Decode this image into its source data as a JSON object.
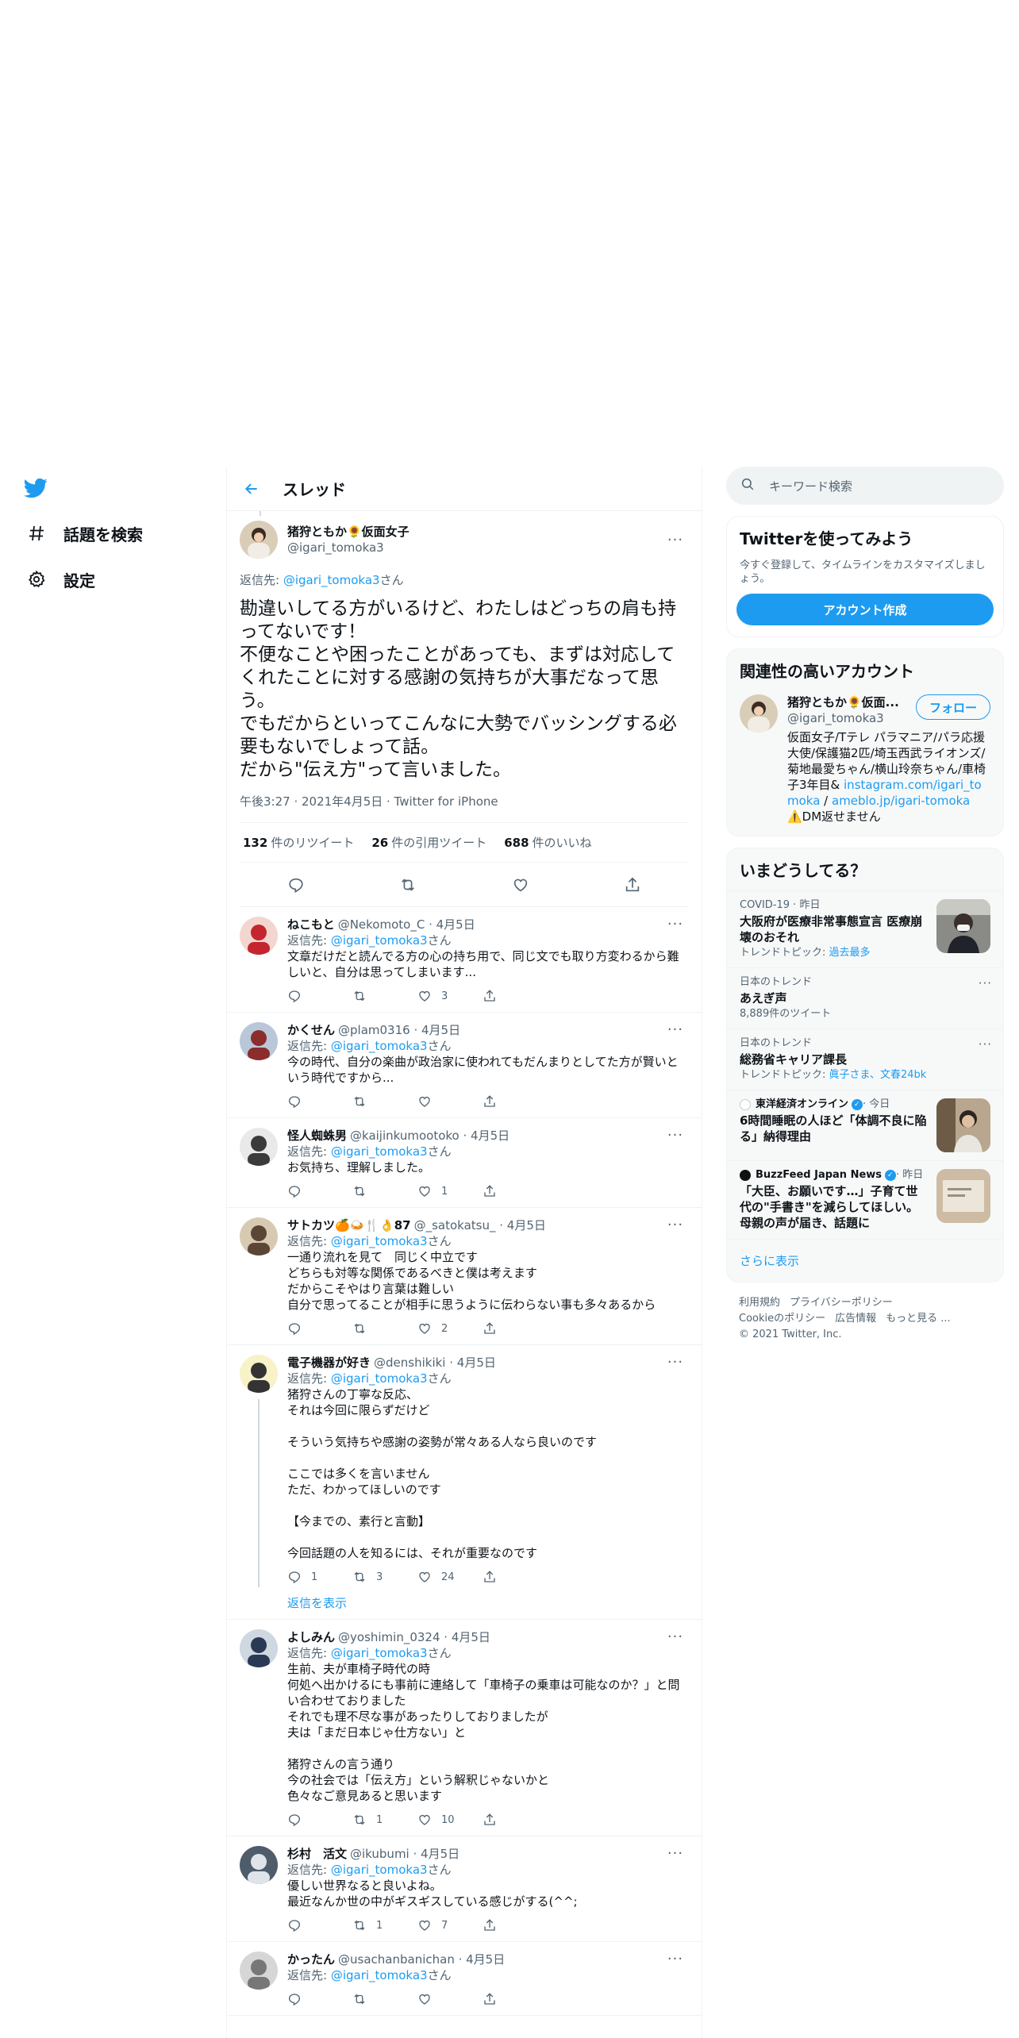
{
  "nav": {
    "logo": "twitter-logo",
    "explore_label": "話題を検索",
    "settings_label": "設定"
  },
  "header": {
    "title": "スレッド"
  },
  "main_tweet": {
    "name": "猪狩ともか🌻仮面女子",
    "handle": "@igari_tomoka3",
    "reply_prefix": "返信先: ",
    "reply_to": "@igari_tomoka3",
    "reply_suffix": "さん",
    "text": "勘違いしてる方がいるけど、わたしはどっちの肩も持ってないです！\n不便なことや困ったことがあっても、まずは対応してくれたことに対する感謝の気持ちが大事だなって思う。\nでもだからといってこんなに大勢でバッシングする必要もないでしょって話。\nだから\"伝え方\"って言いました。",
    "meta": "午後3:27 · 2021年4月5日 · Twitter for iPhone",
    "retweets": "132",
    "retweets_label": "件のリツイート",
    "quotes": "26",
    "quotes_label": "件の引用ツイート",
    "likes": "688",
    "likes_label": "件のいいね"
  },
  "replies": [
    {
      "name": "ねこもと",
      "handle": "@Nekomoto_C · 4月5日",
      "reply_to": "@igari_tomoka3",
      "text": "文章だけだと読んでる方の心の持ち用で、同じ文でも取り方変わるから難しいと、自分は思ってしまいます...",
      "replies": "",
      "retweets": "",
      "likes": "3"
    },
    {
      "name": "かくせん",
      "handle": "@plam0316 · 4月5日",
      "reply_to": "@igari_tomoka3",
      "text": "今の時代、自分の楽曲が政治家に使われてもだんまりとしてた方が賢いという時代ですから...",
      "replies": "",
      "retweets": "",
      "likes": ""
    },
    {
      "name": "怪人蜘蛛男",
      "handle": "@kaijinkumootoko · 4月5日",
      "reply_to": "@igari_tomoka3",
      "text": "お気持ち、理解しました。",
      "replies": "",
      "retweets": "",
      "likes": "1"
    },
    {
      "name": "サトカツ🍊🍛🍴👌87",
      "handle": "@_satokatsu_ · 4月5日",
      "reply_to": "@igari_tomoka3",
      "text": "一通り流れを見て　同じく中立です\nどちらも対等な関係であるべきと僕は考えます\nだからこそやはり言葉は難しい\n自分で思ってることが相手に思うように伝わらない事も多々あるから",
      "replies": "",
      "retweets": "",
      "likes": "2"
    },
    {
      "name": "電子機器が好き",
      "handle": "@denshikiki · 4月5日",
      "reply_to": "@igari_tomoka3",
      "text": "猪狩さんの丁寧な反応、\nそれは今回に限らずだけど\n\nそういう気持ちや感謝の姿勢が常々ある人なら良いのです\n\nここでは多くを言いません\nただ、わかってほしいのです\n\n【今までの、素行と言動】\n\n今回話題の人を知るには、それが重要なのです",
      "replies": "1",
      "retweets": "3",
      "likes": "24",
      "show_replies": "返信を表示"
    },
    {
      "name": "よしみん",
      "handle": "@yoshimin_0324 · 4月5日",
      "reply_to": "@igari_tomoka3",
      "text": "生前、夫が車椅子時代の時\n何処へ出かけるにも事前に連絡して「車椅子の乗車は可能なのか？」と問い合わせておりました\nそれでも理不尽な事があったりしておりましたが\n夫は「まだ日本じゃ仕方ない」と\n\n猪狩さんの言う通り\n今の社会では「伝え方」という解釈じゃないかと\n色々なご意見あると思います",
      "replies": "",
      "retweets": "1",
      "likes": "10"
    },
    {
      "name": "杉村　活文",
      "handle": "@ikubumi · 4月5日",
      "reply_to": "@igari_tomoka3",
      "text": "優しい世界なると良いよね。\n最近なんか世の中がギスギスしている感じがする(^^;",
      "replies": "",
      "retweets": "1",
      "likes": "7"
    },
    {
      "name": "かったん",
      "handle": "@usachanbanichan · 4月5日",
      "reply_to": "@igari_tomoka3",
      "text": "",
      "replies": "",
      "retweets": "",
      "likes": ""
    }
  ],
  "reply_prefix": "返信先: ",
  "reply_suffix": "さん",
  "search": {
    "placeholder": "キーワード検索"
  },
  "signup": {
    "title": "Twitterを使ってみよう",
    "subtitle": "今すぐ登録して、タイムラインをカスタマイズしましょう。",
    "button": "アカウント作成"
  },
  "related": {
    "title": "関連性の高いアカウント",
    "name": "猪狩ともか🌻仮面...",
    "handle": "@igari_tomoka3",
    "follow": "フォロー",
    "bio_text": "仮面女子/Tテレ パラマニア/パラ応援大使/保護猫2匹/埼玉西武ライオンズ/菊地最愛ちゃん/横山玲奈ちゃん/車椅子3年目",
    "bio_sep1": "& ",
    "bio_link1": "instagram.com/igari_tomoka",
    "bio_sep2": " / ",
    "bio_link2": "ameblo.jp/igari-tomoka",
    "bio_tail": " ⚠️DM返せません"
  },
  "trends": {
    "title": "いまどうしてる？",
    "items": [
      {
        "context": "COVID-19 · 昨日",
        "title": "大阪府が医療非常事態宣言 医療崩壊のおそれ",
        "extra_prefix": "トレンドトピック: ",
        "extra_link": "過去最多",
        "has_image": true,
        "image": "news-photo-mask"
      },
      {
        "context": "日本のトレンド",
        "title": "あえぎ声",
        "extra_prefix": "8,889件のツイート",
        "extra_link": "",
        "has_image": false
      },
      {
        "context": "日本のトレンド",
        "title": "総務省キャリア課長",
        "extra_prefix": "トレンドトピック: ",
        "extra_link": "眞子さま、文春24bk",
        "has_image": false
      },
      {
        "context": "東洋経済オンライン",
        "context_suffix": " · 今日",
        "title": "6時間睡眠の人ほど「体調不良に陥る」納得理由",
        "extra_prefix": "",
        "extra_link": "",
        "has_image": true,
        "image": "news-photo-person"
      },
      {
        "context": "BuzzFeed Japan News",
        "context_suffix": " · 昨日",
        "title": "「大臣、お願いです…」子育て世代の\"手書き\"を減らしてほしい。母親の声が届き、話題に",
        "extra_prefix": "",
        "extra_link": "",
        "has_image": true,
        "image": "news-photo-document"
      }
    ],
    "show_more": "さらに表示"
  },
  "footer": {
    "terms": "利用規約",
    "privacy": "プライバシーポリシー",
    "cookies": "Cookieのポリシー",
    "ads": "広告情報",
    "more": "もっと見る ...",
    "copyright": "© 2021 Twitter, Inc."
  },
  "colors": {
    "accent": "#1d9bf0",
    "text": "#0f1419",
    "secondary": "#536471",
    "border": "#eff3f4"
  }
}
